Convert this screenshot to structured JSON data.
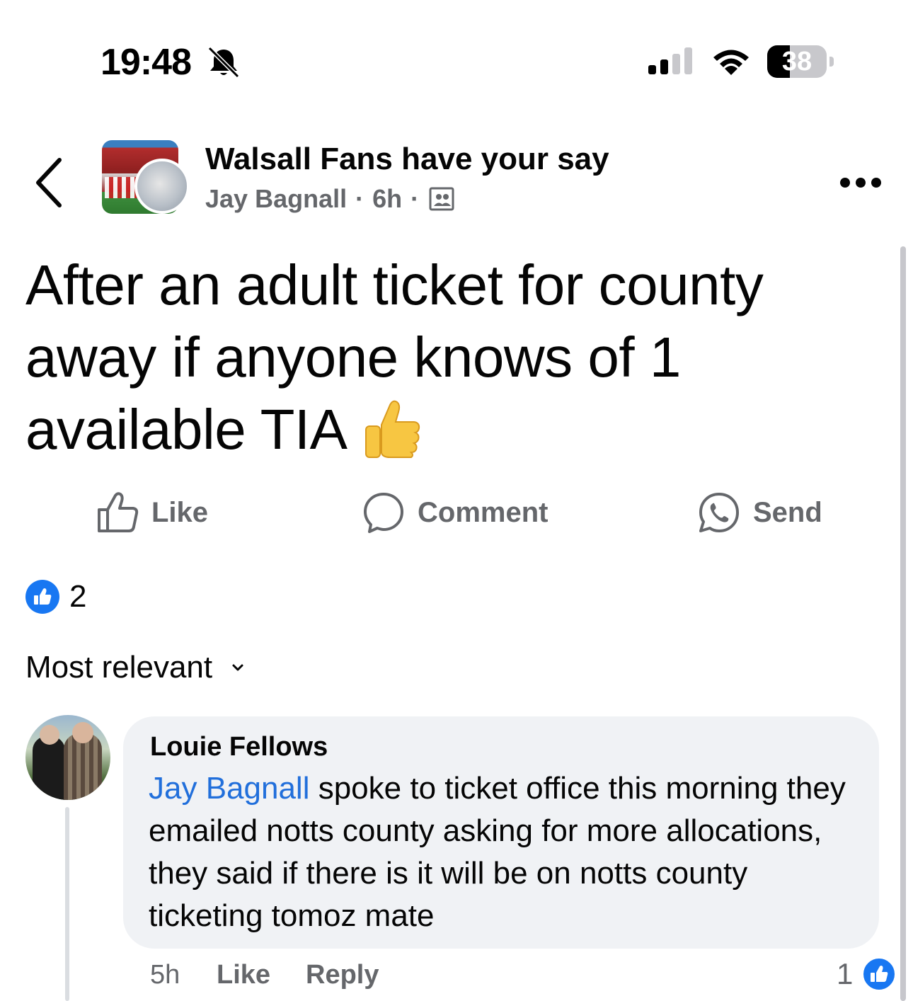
{
  "status_bar": {
    "time": "19:48",
    "battery": "38",
    "battery_level": 0.38
  },
  "header": {
    "group_name": "Walsall Fans have your say",
    "author": "Jay Bagnall",
    "separator": "·",
    "age": "6h"
  },
  "post": {
    "text": "After an adult ticket for county away if anyone knows of 1 available TIA"
  },
  "actions": {
    "like_label": "Like",
    "comment_label": "Comment",
    "send_label": "Send"
  },
  "reactions": {
    "count": "2"
  },
  "sort": {
    "label": "Most relevant"
  },
  "comments": [
    {
      "author": "Louie Fellows",
      "mention": "Jay Bagnall",
      "text": " spoke to ticket office this morning they emailed notts county asking for more allocations, they said if there is it will be on notts county ticketing tomoz mate",
      "time": "5h",
      "like_label": "Like",
      "reply_label": "Reply",
      "reaction_count": "1"
    }
  ],
  "colors": {
    "accent": "#1877f2",
    "mention": "#216fdb",
    "secondary_text": "#65676b",
    "bubble": "#f0f2f5"
  },
  "icons": [
    "bell-off-icon",
    "signal-icon",
    "wifi-icon",
    "battery-icon",
    "back-chevron-icon",
    "more-icon",
    "group-icon",
    "thumbs-up-emoji",
    "like-icon",
    "comment-icon",
    "whatsapp-icon",
    "chevron-down-icon"
  ]
}
